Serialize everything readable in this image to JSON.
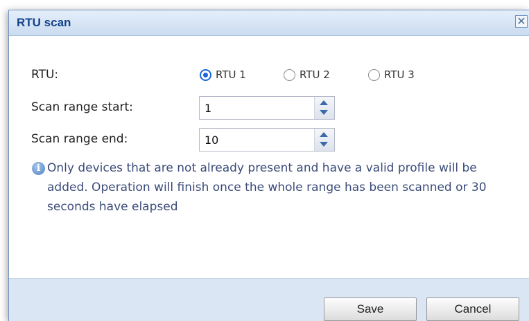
{
  "dialog": {
    "title": "RTU scan",
    "close_glyph": "✕"
  },
  "form": {
    "rtu_label": "RTU:",
    "rtu_options": [
      {
        "label": "RTU 1",
        "checked": true
      },
      {
        "label": "RTU 2",
        "checked": false
      },
      {
        "label": "RTU 3",
        "checked": false
      }
    ],
    "scan_start_label": "Scan range start:",
    "scan_start_value": "1",
    "scan_end_label": "Scan range end:",
    "scan_end_value": "10"
  },
  "info": {
    "icon": "info-icon",
    "icon_glyph": "i",
    "text": "Only devices that are not already present and have a valid profile will be added. Operation will finish once the whole range has been scanned or 30 seconds have elapsed"
  },
  "footer": {
    "save_label": "Save",
    "cancel_label": "Cancel"
  },
  "colors": {
    "title_text": "#15428b",
    "radio_accent": "#1b66d8",
    "footer_bg": "#dbe6f4"
  }
}
